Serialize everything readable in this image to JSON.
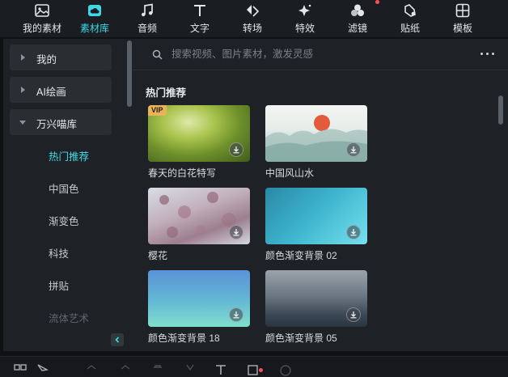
{
  "toolbar": {
    "items": [
      {
        "label": "我的素材",
        "icon": "image-icon"
      },
      {
        "label": "素材库",
        "icon": "cloud-folder-icon",
        "active": true
      },
      {
        "label": "音频",
        "icon": "music-note-icon"
      },
      {
        "label": "文字",
        "icon": "text-t-icon"
      },
      {
        "label": "转场",
        "icon": "transition-arrows-icon"
      },
      {
        "label": "特效",
        "icon": "sparkle-star-icon"
      },
      {
        "label": "滤镜",
        "icon": "filter-circles-icon",
        "badge": true
      },
      {
        "label": "贴纸",
        "icon": "sticker-icon"
      },
      {
        "label": "模板",
        "icon": "template-grid-icon"
      }
    ]
  },
  "sidebar": {
    "groups": [
      {
        "label": "我的",
        "expanded": false
      },
      {
        "label": "AI绘画",
        "expanded": false
      },
      {
        "label": "万兴喵库",
        "expanded": true
      }
    ],
    "sub_items": [
      {
        "label": "热门推荐",
        "active": true
      },
      {
        "label": "中国色"
      },
      {
        "label": "渐变色"
      },
      {
        "label": "科技"
      },
      {
        "label": "拼贴"
      },
      {
        "label": "流体艺术"
      }
    ]
  },
  "search": {
    "placeholder": "搜索视频、图片素材，激发灵感"
  },
  "section": {
    "title": "热门推荐"
  },
  "cards": [
    {
      "name": "春天的白花特写",
      "vip": "VIP"
    },
    {
      "name": "中国风山水"
    },
    {
      "name": "樱花"
    },
    {
      "name": "颜色渐变背景 02"
    },
    {
      "name": "颜色渐变背景 18"
    },
    {
      "name": "颜色渐变背景 05"
    }
  ],
  "colors": {
    "accent": "#3fd8e6",
    "badge": "#ff4d5e",
    "vip": "#e8b35a"
  }
}
